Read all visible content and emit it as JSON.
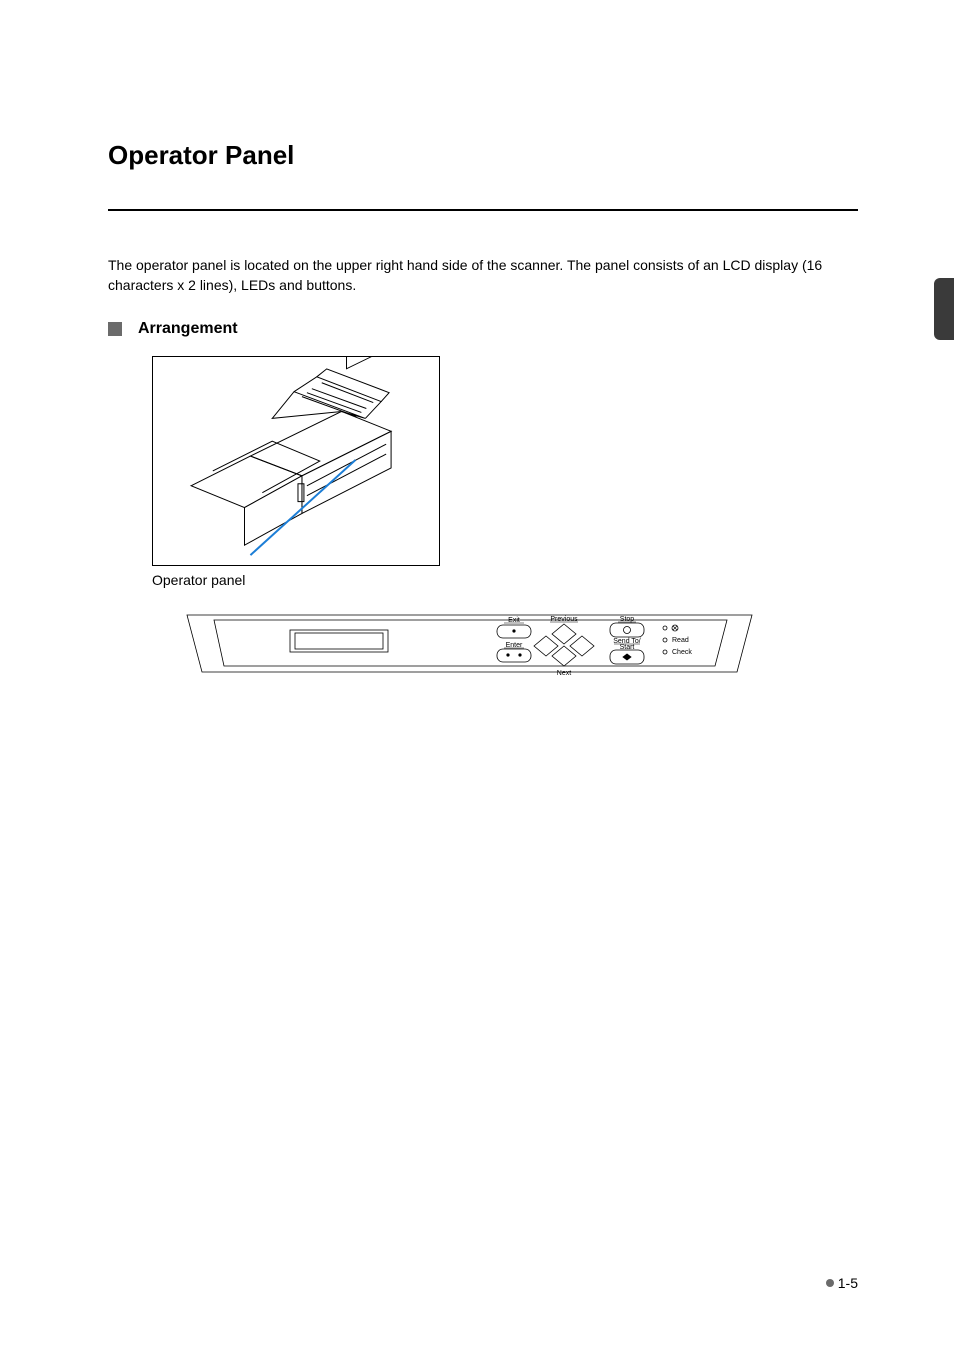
{
  "title": "Operator Panel",
  "intro": "The operator panel is located on the upper right hand side of the scanner.  The panel consists of an LCD display (16 characters x 2 lines), LEDs and buttons.",
  "section_heading": "Arrangement",
  "caption": "Operator panel",
  "panel": {
    "exit": "Exit",
    "enter": "Enter",
    "previous": "Previous",
    "next": "Next",
    "stop": "Stop",
    "send_to": "Send To/",
    "start": "Start",
    "read": "Read",
    "check": "Check"
  },
  "page_number": "1-5"
}
